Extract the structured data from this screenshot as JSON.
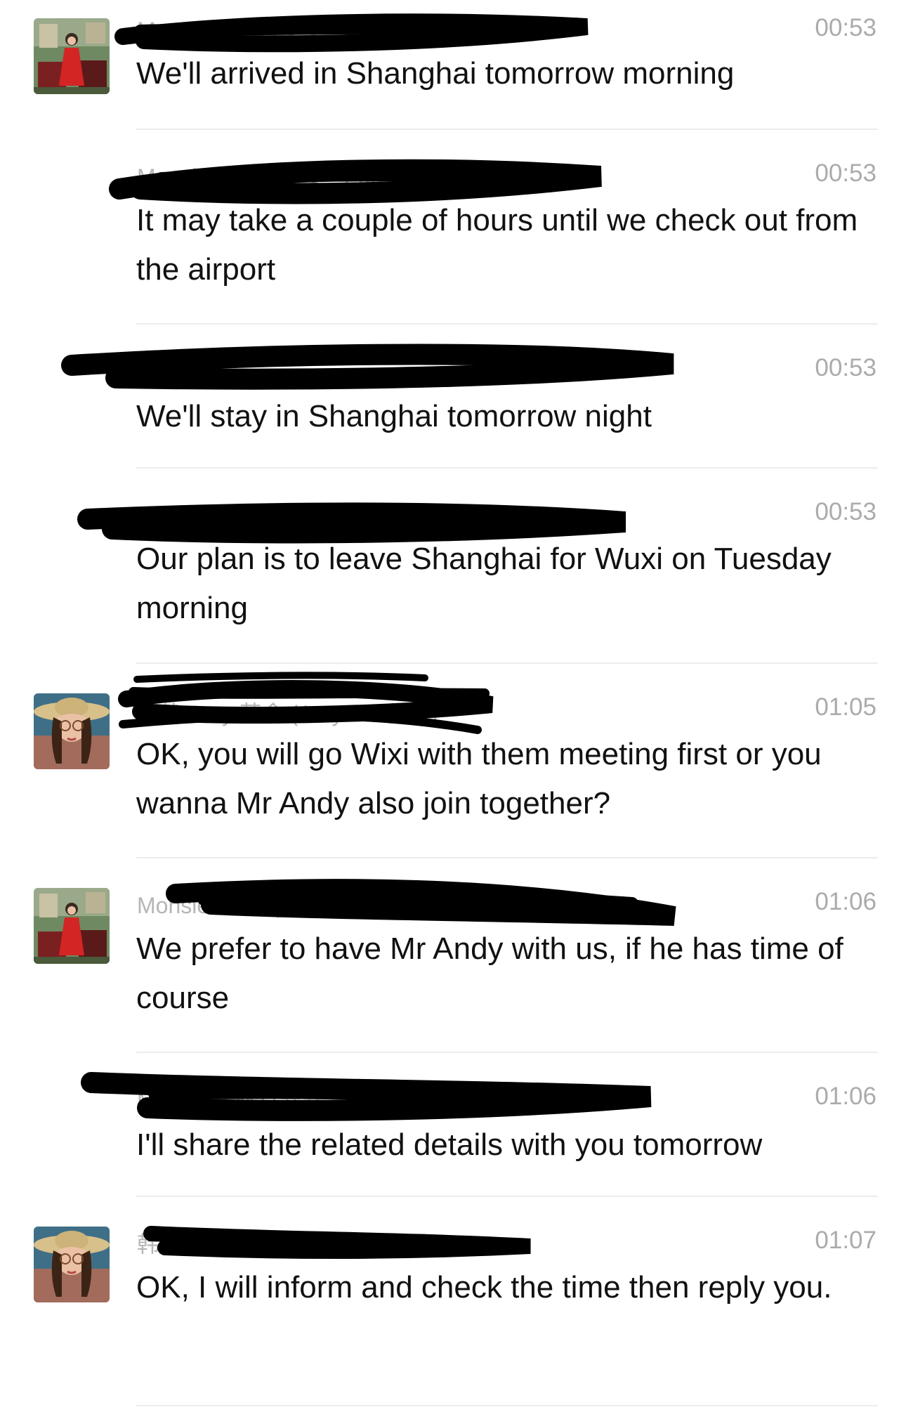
{
  "messages": [
    {
      "sender": "Monsieur MJ (安安 - Zuo dian tianrose)",
      "avatar": "red-dress-woman-avatar",
      "time": "00:53",
      "text": "We'll arrived in Shanghai tomorrow morning"
    },
    {
      "sender": "Monsieur MJ (安安 - Zuo dian tianrose)",
      "avatar": "",
      "time": "00:53",
      "text": "It may take a couple of hours until we check out from the airport"
    },
    {
      "sender": "",
      "avatar": "",
      "time": "00:53",
      "text": "We'll stay in Shanghai tomorrow night"
    },
    {
      "sender": "Monsieur MJ (安安 - Zuo dian tianrose)",
      "avatar": "",
      "time": "00:53",
      "text": "Our plan is to leave Shanghai for Wuxi on Tuesday morning"
    },
    {
      "sender": "韩静 Amy 英舍 (Amy - 工作号)",
      "avatar": "straw-hat-woman-avatar",
      "time": "01:05",
      "text": "OK, you will go Wixi with them meeting first or you wanna Mr Andy also join together?"
    },
    {
      "sender": "Monsieur MJ (安安 - Zuo dian tianrose)",
      "avatar": "red-dress-woman-avatar",
      "time": "01:06",
      "text": "We prefer to have Mr Andy with us, if he has time of course"
    },
    {
      "sender": "Monsieur MJ (安安 - Zuo dian tianrose)",
      "avatar": "",
      "time": "01:06",
      "text": "I'll share the related details with you tomorrow"
    },
    {
      "sender": "韩静 Amy 英舍 (Amy - 工作号)",
      "avatar": "straw-hat-woman-avatar",
      "time": "01:07",
      "text": "OK, I will inform and check the time then reply you."
    }
  ]
}
